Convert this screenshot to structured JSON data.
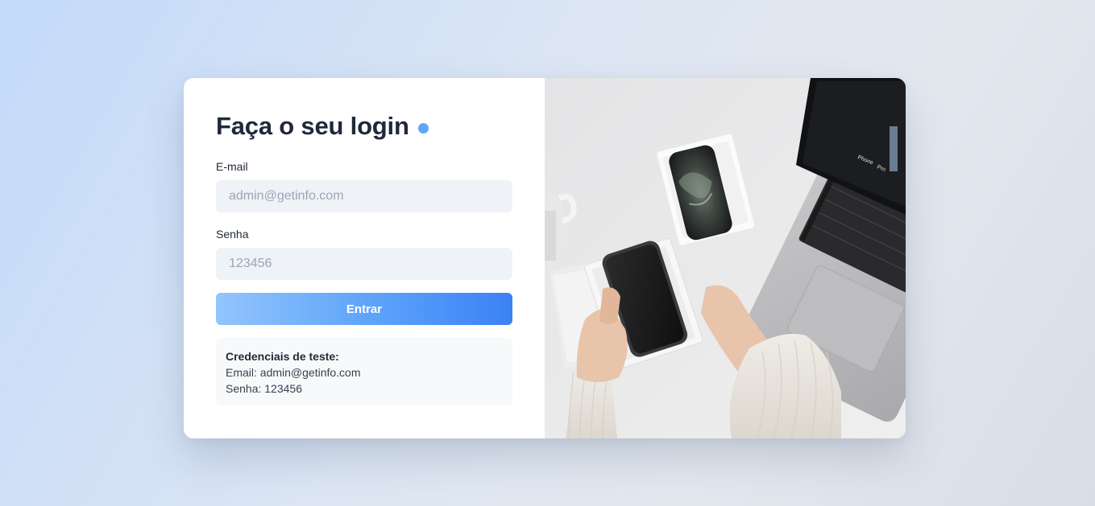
{
  "login": {
    "title": "Faça o seu login",
    "email_label": "E-mail",
    "email_placeholder": "admin@getinfo.com",
    "email_value": "",
    "password_label": "Senha",
    "password_placeholder": "123456",
    "password_value": "",
    "submit_label": "Entrar"
  },
  "credentials": {
    "heading": "Credenciais de teste:",
    "email_line": "Email: admin@getinfo.com",
    "password_line": "Senha: 123456"
  },
  "hero_image": {
    "description_icon": "photo-icon",
    "screen_text_1": "Phone",
    "screen_text_2": "Pro"
  },
  "colors": {
    "accent": "#60a5fa",
    "button_start": "#93c5fd",
    "button_end": "#3b82f6",
    "title": "#1e293b"
  }
}
